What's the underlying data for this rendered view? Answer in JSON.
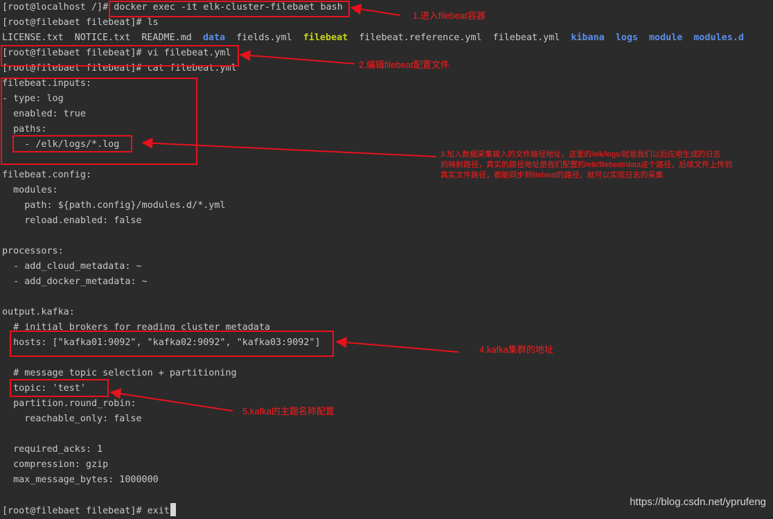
{
  "terminal": {
    "l01": "[root@localhost /]# docker exec -it elk-cluster-filebaet bash",
    "l02": "[root@filebaet filebeat]# ls",
    "ls_items": [
      {
        "name": "LICENSE.txt",
        "kind": "file"
      },
      {
        "name": "NOTICE.txt",
        "kind": "file"
      },
      {
        "name": "README.md",
        "kind": "file"
      },
      {
        "name": "data",
        "kind": "dir"
      },
      {
        "name": "fields.yml",
        "kind": "file"
      },
      {
        "name": "filebeat",
        "kind": "exec"
      },
      {
        "name": "filebeat.reference.yml",
        "kind": "file"
      },
      {
        "name": "filebeat.yml",
        "kind": "file"
      },
      {
        "name": "kibana",
        "kind": "dir"
      },
      {
        "name": "logs",
        "kind": "dir"
      },
      {
        "name": "module",
        "kind": "dir"
      },
      {
        "name": "modules.d",
        "kind": "dir"
      }
    ],
    "l04": "[root@filebaet filebeat]# vi filebeat.yml",
    "l05": "[root@filebaet filebeat]# cat filebeat.yml",
    "l06": "filebeat.inputs:",
    "l07": "- type: log",
    "l08": "  enabled: true",
    "l09": "  paths:",
    "l10": "    - /elk/logs/*.log",
    "l12": "filebeat.config:",
    "l13": "  modules:",
    "l14": "    path: ${path.config}/modules.d/*.yml",
    "l15": "    reload.enabled: false",
    "l17": "processors:",
    "l18": "  - add_cloud_metadata: ~",
    "l19": "  - add_docker_metadata: ~",
    "l21": "output.kafka:",
    "l22": "  # initial brokers for reading cluster metadata",
    "l23": "  hosts: [\"kafka01:9092\", \"kafka02:9092\", \"kafka03:9092\"]",
    "l25": "  # message topic selection + partitioning",
    "l26": "  topic: 'test'",
    "l27": "  partition.round_robin:",
    "l28": "    reachable_only: false",
    "l30": "  required_acks: 1",
    "l31": "  compression: gzip",
    "l32": "  max_message_bytes: 1000000",
    "l34": "[root@filebaet filebeat]# exit"
  },
  "annotations": {
    "a1": "1.进入filebeat容器",
    "a2": "2.编辑filebeat配置文件",
    "a3_line1": "3.加入数据采集输入的文件路径地址，这里的/elk/logs/就是我们以后应用生成的日志",
    "a3_line2": "的映射路径，真实的路径地址是我们配置的/elk/filebeat/data这个路径，后续文件上传到",
    "a3_line3": "真实文件路径，都能同步到filebeat的路径，就可以实现日志的采集",
    "a4": "4.kafka集群的地址",
    "a5": "5.kafka的主题名称配置"
  },
  "watermark": "https://blog.csdn.net/yprufeng",
  "colors": {
    "background": "#2b2b2b",
    "text": "#c9c9c9",
    "directory": "#5b8ee6",
    "executable": "#c4d31a",
    "annotation": "#e8121d"
  }
}
